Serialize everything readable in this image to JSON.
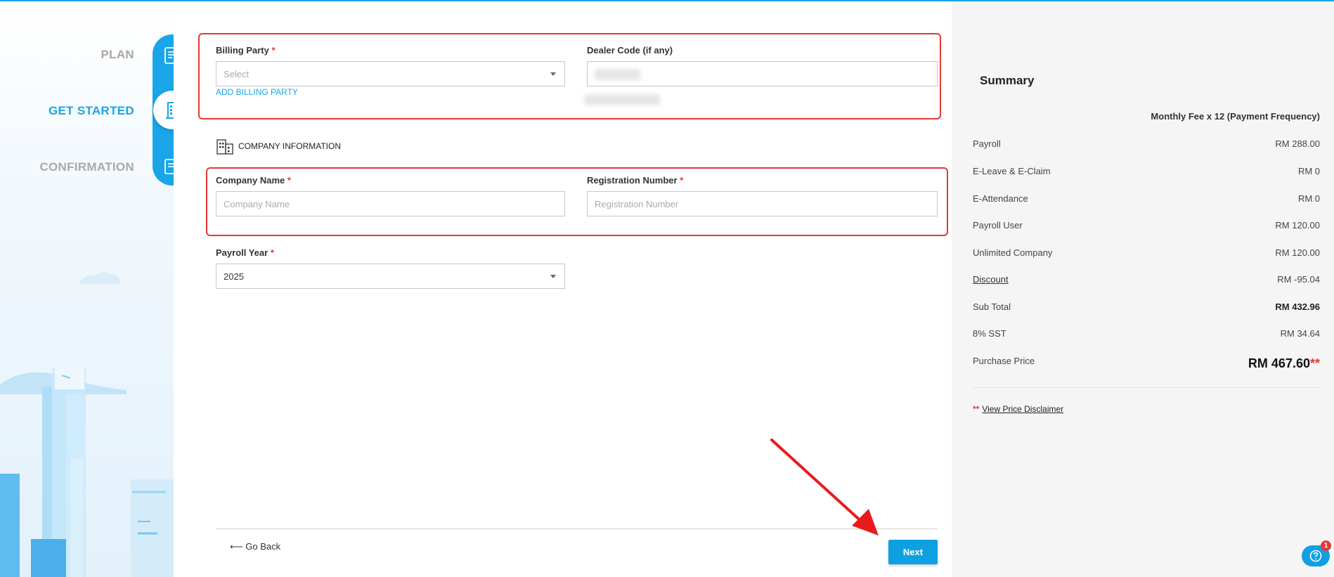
{
  "stepper": {
    "steps": [
      {
        "label": "PLAN",
        "state": "inactive",
        "icon": "edit-form-icon"
      },
      {
        "label": "GET STARTED",
        "state": "active",
        "icon": "building-icon"
      },
      {
        "label": "CONFIRMATION",
        "state": "inactive",
        "icon": "approved-form-icon"
      }
    ]
  },
  "form": {
    "billing_party": {
      "label": "Billing Party",
      "required": "*",
      "placeholder": "Select",
      "add_link": "ADD BILLING PARTY"
    },
    "dealer_code": {
      "label": "Dealer Code (if any)"
    },
    "company_section": {
      "title": "COMPANY INFORMATION",
      "icon": "building-outline-icon"
    },
    "company_name": {
      "label": "Company Name",
      "required": "*",
      "placeholder": "Company Name"
    },
    "registration_number": {
      "label": "Registration Number",
      "required": "*",
      "placeholder": "Registration Number"
    },
    "payroll_year": {
      "label": "Payroll Year",
      "required": "*",
      "value": "2025"
    }
  },
  "footer": {
    "go_back": "⟵ Go Back",
    "next": "Next"
  },
  "summary": {
    "title": "Summary",
    "frequency": "Monthly Fee x 12 (Payment Frequency)",
    "rows": [
      {
        "label": "Payroll",
        "value": "RM 288.00"
      },
      {
        "label": "E-Leave & E-Claim",
        "value": "RM 0"
      },
      {
        "label": "E-Attendance",
        "value": "RM 0"
      },
      {
        "label": "Payroll User",
        "value": "RM 120.00"
      },
      {
        "label": "Unlimited Company",
        "value": "RM 120.00"
      },
      {
        "label": "Discount",
        "value": "RM -95.04"
      },
      {
        "label": "Sub Total",
        "value": "RM 432.96"
      },
      {
        "label": "8% SST",
        "value": "RM 34.64"
      }
    ],
    "purchase_label": "Purchase Price",
    "purchase_value": "RM 467.60",
    "purchase_stars": "**",
    "disclaimer_stars": "**",
    "disclaimer_link": "View Price Disclaimer"
  },
  "help": {
    "badge": "1"
  },
  "colors": {
    "accent": "#19a5e8",
    "highlight": "#e53935",
    "summary_bg": "#f5f5f5"
  }
}
